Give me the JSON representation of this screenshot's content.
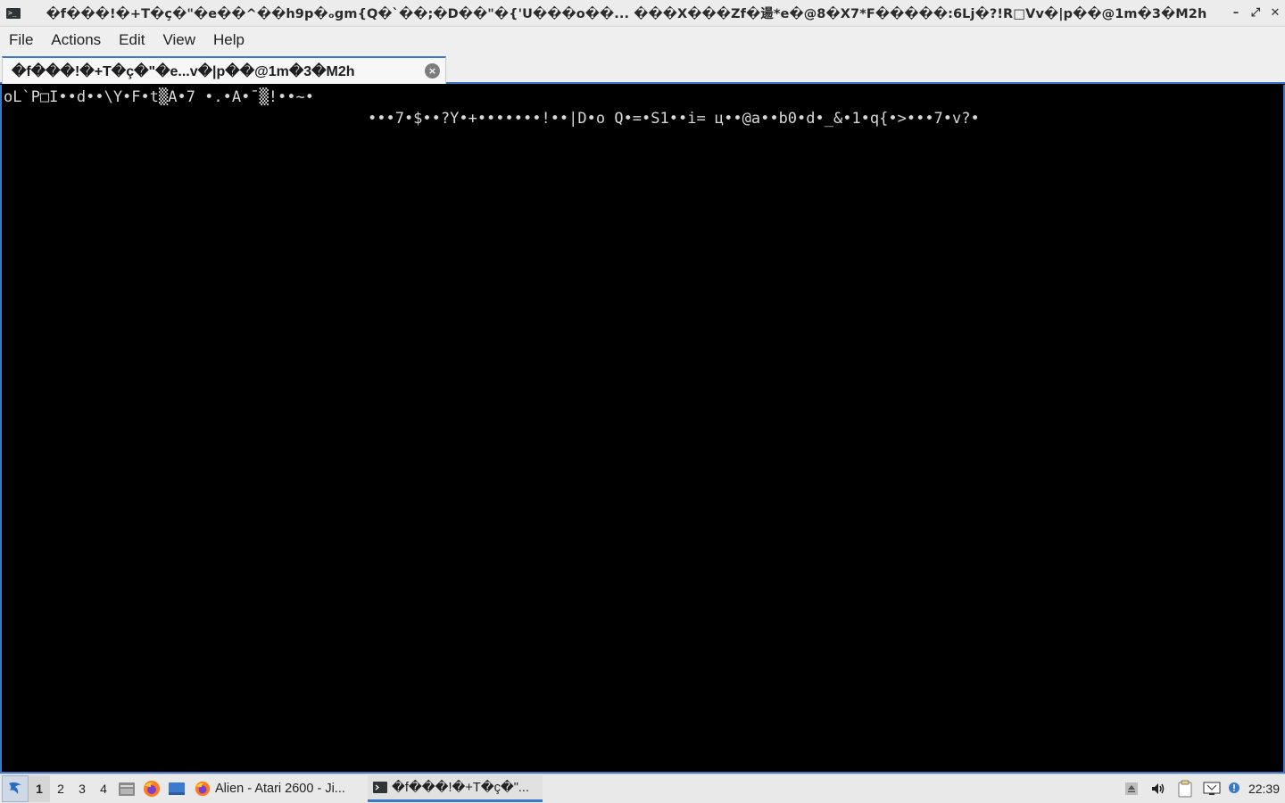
{
  "window": {
    "title": "�f���!�+T�ç�\"�e��^��h9p�ₒgm{Q�`��;�D��\"�{'U���o��...   ���X���Zf�逿*e�@8�X7*F�����:6Lj�?!R□Vv�|p��@1m�3�M2h",
    "icon": "terminal-icon",
    "controls": [
      "minimize-icon",
      "maximize-icon",
      "close-icon"
    ],
    "minimize_glyph": "–",
    "maximize_glyph": "⤢",
    "close_glyph": "✕"
  },
  "menubar": {
    "items": [
      "File",
      "Actions",
      "Edit",
      "View",
      "Help"
    ]
  },
  "tabs": [
    {
      "label": "�f���!�+T�ç�\"�e...v�|p��@1m�3�M2h",
      "close_glyph": "×",
      "active": true
    }
  ],
  "terminal": {
    "lines": [
      "oL`P□I••d••\\Y•F•t▒A•7 •.•A•¯▒!••~•",
      "•••7•$••?Y•+•••••••!••|D•o Q•=•S1••i= ц••@a••b0•d•_&•1•q{•>•••7•v?•"
    ],
    "background": "#000000",
    "foreground": "#d8d8d8"
  },
  "taskbar": {
    "start_icon": "start-menu-icon",
    "desktops": [
      "1",
      "2",
      "3",
      "4"
    ],
    "active_desktop": "1",
    "launchers": [
      "file-manager-icon",
      "firefox-icon",
      "desktop-icon"
    ],
    "tasks": [
      {
        "label": "Alien - Atari 2600 - Ji...",
        "icon": "firefox-icon",
        "active": false
      },
      {
        "label": "�f���!�+T�ç�\"...",
        "icon": "terminal-icon",
        "active": true
      }
    ],
    "tray": [
      "eject-icon",
      "volume-icon",
      "clipboard-icon",
      "network-icon",
      "update-icon"
    ],
    "clock": "22:39"
  },
  "colors": {
    "accent": "#3c78c8",
    "chrome": "#ececec"
  }
}
